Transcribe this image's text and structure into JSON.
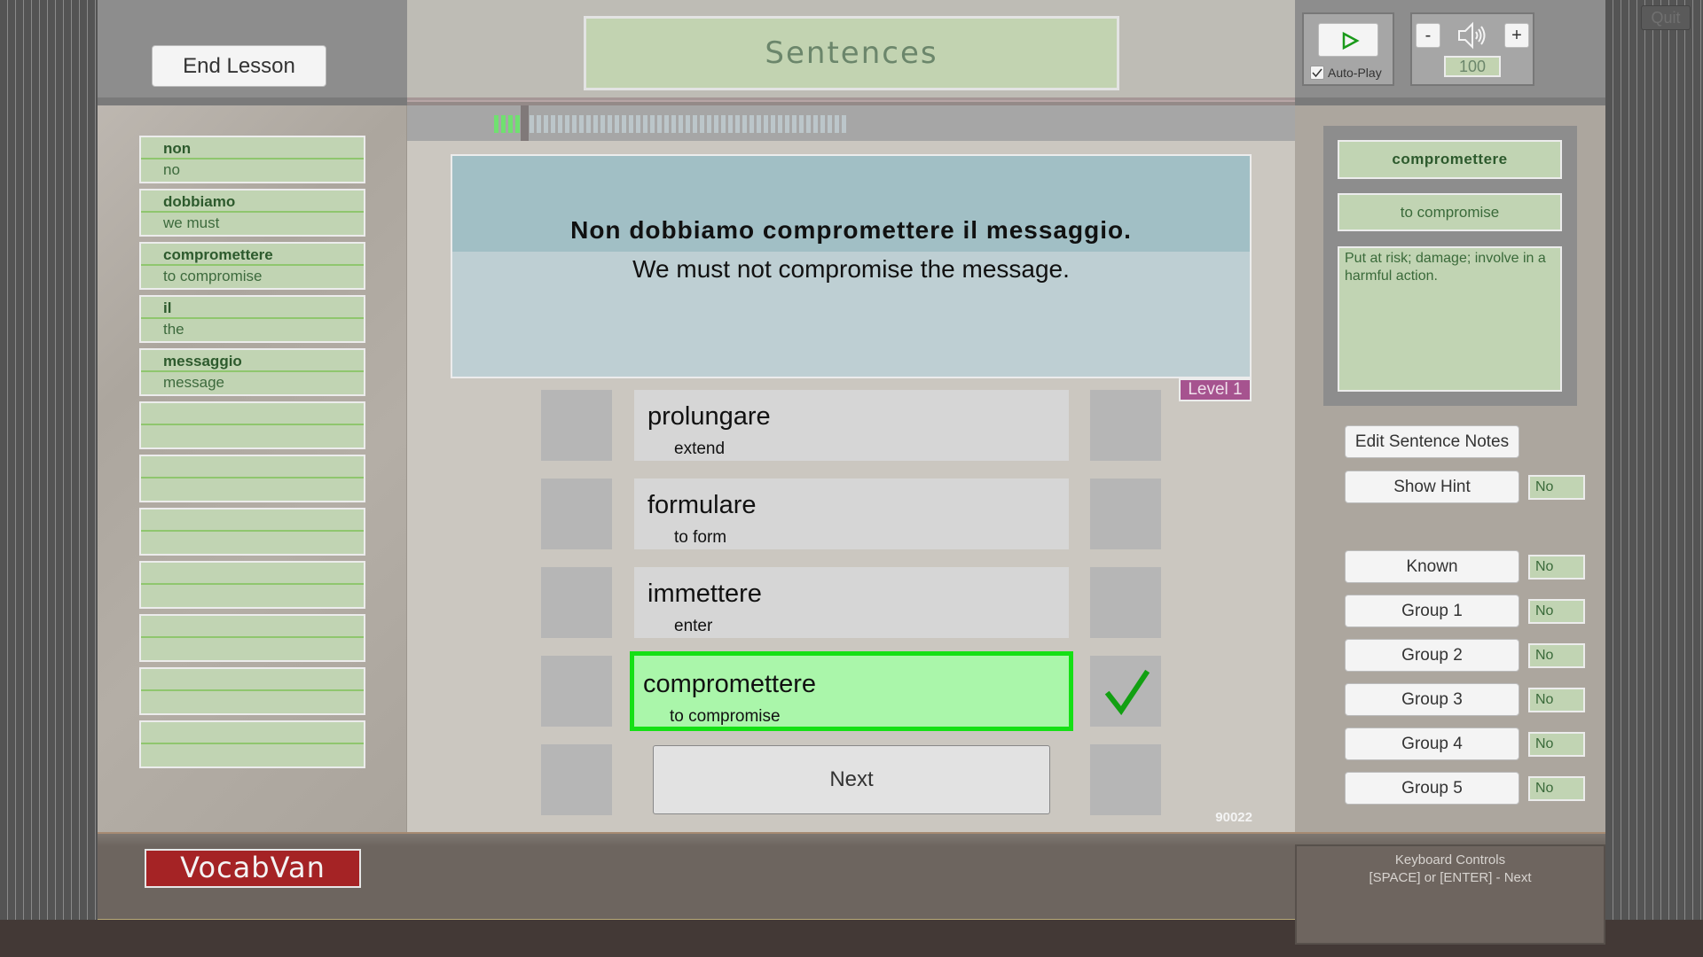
{
  "header": {
    "end_lesson_label": "End Lesson",
    "title": "Sentences",
    "quit_label": "Quit"
  },
  "progress": {
    "completed": 5,
    "total": 50,
    "done_color": "#70e070",
    "todo_color": "#bcc6ca"
  },
  "audio": {
    "play_icon": "play-icon",
    "autoplay_label": "Auto-Play",
    "autoplay_checked": true,
    "volume_minus_label": "-",
    "volume_plus_label": "+",
    "volume_icon": "speaker-icon",
    "volume_value": "100"
  },
  "sentence_words": [
    {
      "word": "non",
      "translation": "no"
    },
    {
      "word": "dobbiamo",
      "translation": "we must"
    },
    {
      "word": "compromettere",
      "translation": "to compromise"
    },
    {
      "word": "il",
      "translation": "the"
    },
    {
      "word": "messaggio",
      "translation": "message"
    },
    {
      "word": "",
      "translation": ""
    },
    {
      "word": "",
      "translation": ""
    },
    {
      "word": "",
      "translation": ""
    },
    {
      "word": "",
      "translation": ""
    },
    {
      "word": "",
      "translation": ""
    },
    {
      "word": "",
      "translation": ""
    },
    {
      "word": "",
      "translation": ""
    }
  ],
  "sentence": {
    "italian": "Non dobbiamo compromettere il messaggio.",
    "english": "We must not compromise the message.",
    "level": "Level 1",
    "id": "90022"
  },
  "options": [
    {
      "word": "prolungare",
      "translation": "extend",
      "correct": false
    },
    {
      "word": "formulare",
      "translation": "to form",
      "correct": false
    },
    {
      "word": "immettere",
      "translation": "enter",
      "correct": false
    },
    {
      "word": "compromettere",
      "translation": "to compromise",
      "correct": true
    }
  ],
  "next_label": "Next",
  "word_info": {
    "word": "compromettere",
    "translation": "to compromise",
    "definition": "Put at risk; damage; involve in a harmful action."
  },
  "side_buttons": {
    "edit_notes_label": "Edit Sentence Notes",
    "show_hint_label": "Show Hint",
    "show_hint_value": "No",
    "flags": [
      {
        "label": "Known",
        "value": "No"
      },
      {
        "label": "Group 1",
        "value": "No"
      },
      {
        "label": "Group 2",
        "value": "No"
      },
      {
        "label": "Group 3",
        "value": "No"
      },
      {
        "label": "Group 4",
        "value": "No"
      },
      {
        "label": "Group 5",
        "value": "No"
      }
    ]
  },
  "footer": {
    "logo": "VocabVan",
    "keyboard_title": "Keyboard Controls",
    "keyboard_hint": "[SPACE] or [ENTER] - Next"
  },
  "colors": {
    "correct_border": "#15e015",
    "correct_fill": "#aaf6aa",
    "level_tag": "#a6538f",
    "logo_red": "#a52325"
  }
}
